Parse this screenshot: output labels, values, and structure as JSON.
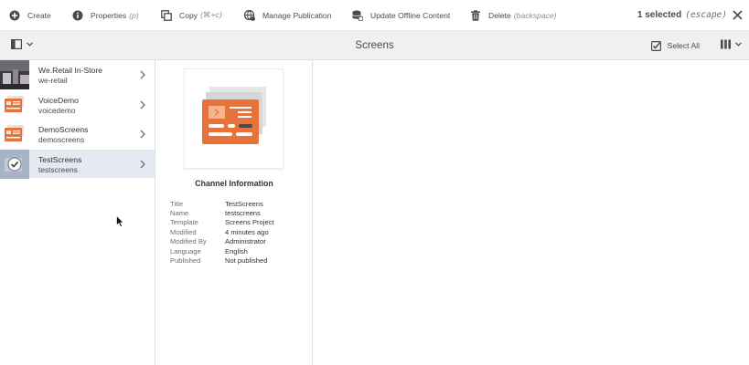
{
  "actions": {
    "create": "Create",
    "properties": "Properties",
    "properties_hint": "(p)",
    "copy": "Copy",
    "copy_hint": "(⌘+c)",
    "manage_publication": "Manage Publication",
    "update_offline": "Update Offline Content",
    "delete": "Delete",
    "delete_hint": "(backspace)"
  },
  "selection": {
    "count": "1 selected",
    "hint": "(escape)"
  },
  "header": {
    "title": "Screens",
    "select_all": "Select All"
  },
  "column1": {
    "items": [
      {
        "title": "We.Retail In-Store",
        "name": "we-retail",
        "thumb": "photo"
      },
      {
        "title": "VoiceDemo",
        "name": "voicedemo",
        "thumb": "project"
      },
      {
        "title": "DemoScreens",
        "name": "demoscreens",
        "thumb": "project"
      },
      {
        "title": "TestScreens",
        "name": "testscreens",
        "thumb": "check",
        "selected": true
      }
    ]
  },
  "details": {
    "heading": "Channel Information",
    "properties": [
      {
        "key": "Title",
        "value": "TestScreens"
      },
      {
        "key": "Name",
        "value": "testscreens"
      },
      {
        "key": "Template",
        "value": "Screens Project"
      },
      {
        "key": "Modified",
        "value": "4 minutes ago"
      },
      {
        "key": "Modified By",
        "value": "Administrator"
      },
      {
        "key": "Language",
        "value": "English"
      },
      {
        "key": "Published",
        "value": "Not published"
      }
    ]
  },
  "colors": {
    "accent_orange": "#e8733a",
    "selected_bg": "#e4e9f2",
    "header_bg": "#f0f0f0"
  }
}
